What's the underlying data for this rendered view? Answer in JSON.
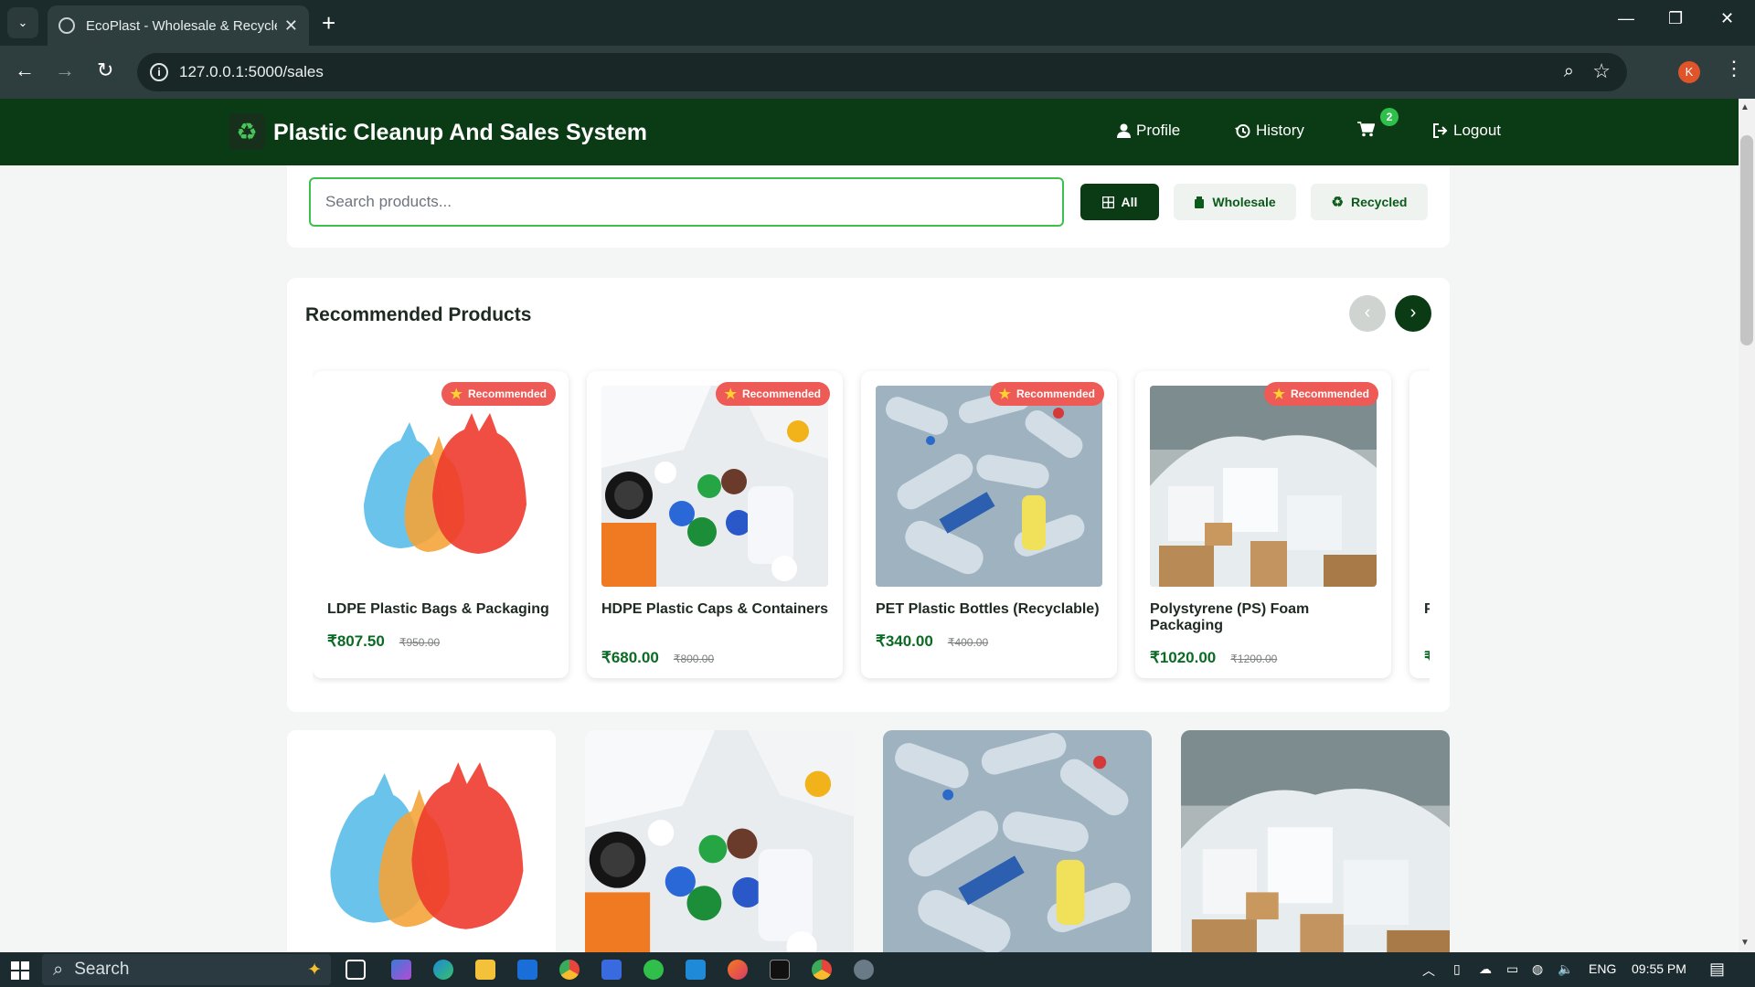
{
  "browser": {
    "tab_title": "EcoPlast - Wholesale & Recycle",
    "url": "127.0.0.1:5000/sales",
    "profile_initial": "K"
  },
  "header": {
    "title": "Plastic Cleanup And Sales System",
    "nav": {
      "profile": "Profile",
      "history": "History",
      "cart_count": "2",
      "logout": "Logout"
    }
  },
  "search": {
    "placeholder": "Search products...",
    "filters": {
      "all": "All",
      "wholesale": "Wholesale",
      "recycled": "Recycled"
    }
  },
  "recommended": {
    "title": "Recommended Products",
    "badge": "Recommended",
    "products": [
      {
        "name": "LDPE Plastic Bags & Packaging",
        "price": "₹807.50",
        "old_price": "₹950.00",
        "image": "plastic-bags"
      },
      {
        "name": "HDPE Plastic Caps & Containers",
        "price": "₹680.00",
        "old_price": "₹800.00",
        "image": "plastic-caps"
      },
      {
        "name": "PET Plastic Bottles (Recyclable)",
        "price": "₹340.00",
        "old_price": "₹400.00",
        "image": "plastic-bottles"
      },
      {
        "name": "Polystyrene (PS) Foam Packaging",
        "price": "₹1020.00",
        "old_price": "₹1200.00",
        "image": "foam-blocks"
      },
      {
        "name": "P C",
        "price": "₹",
        "old_price": "",
        "image": ""
      }
    ]
  },
  "taskbar": {
    "search_label": "Search",
    "language": "ENG",
    "time": "09:55 PM"
  },
  "colors": {
    "header_green": "#0b3b14",
    "accent_green": "#3ec04f",
    "price_green": "#0b6a24",
    "badge_red": "#ee5a55"
  }
}
